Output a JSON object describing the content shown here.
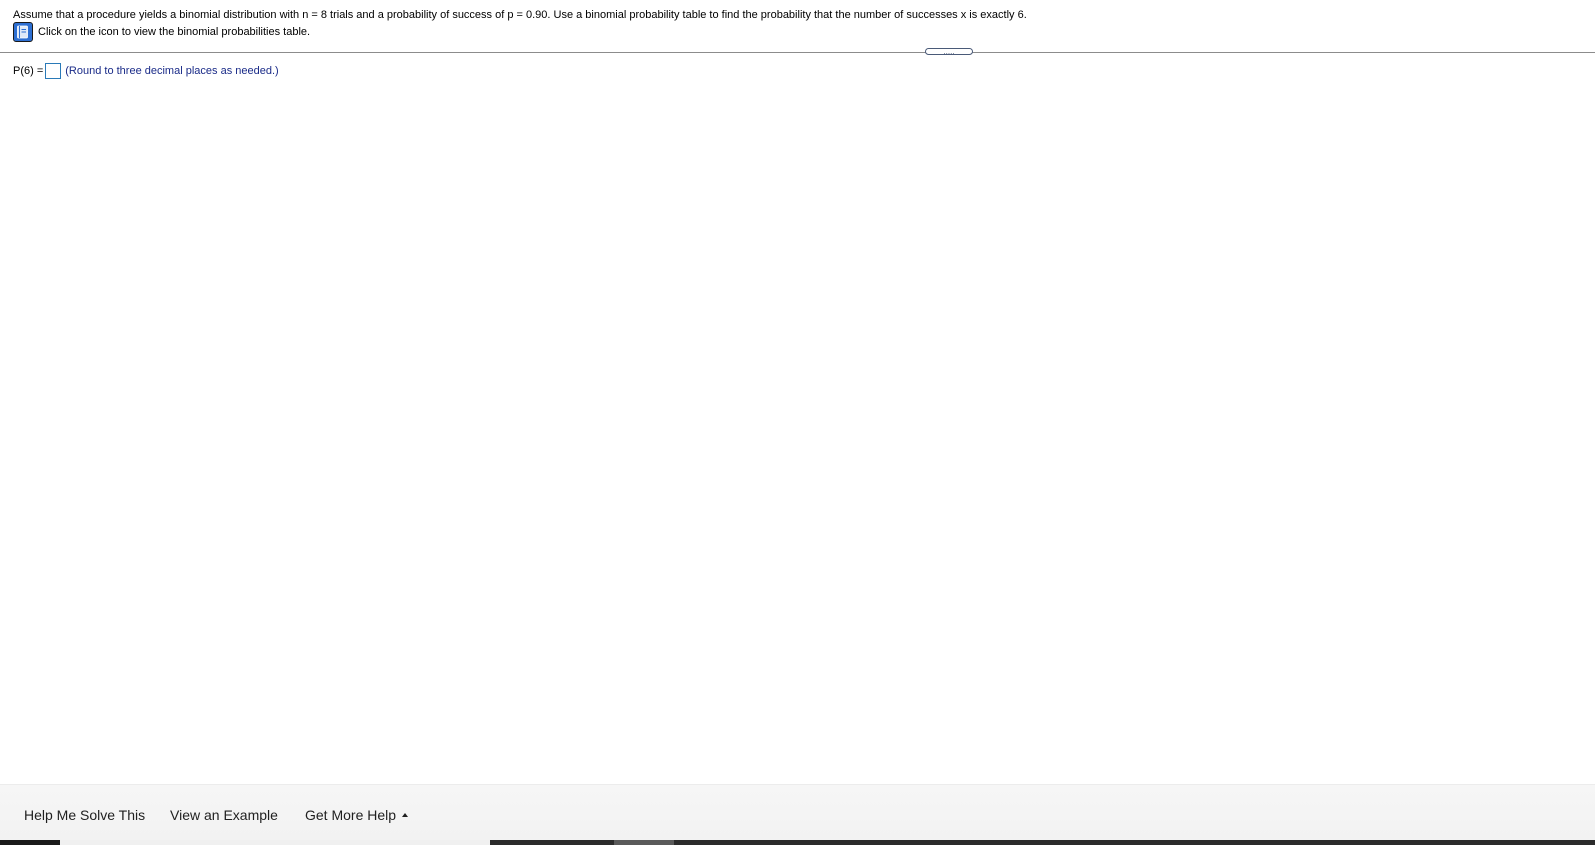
{
  "question": {
    "text": "Assume that a procedure yields a binomial distribution with n = 8 trials and a probability of success of p = 0.90. Use a binomial probability table to find the probability that the number of successes x is exactly 6."
  },
  "table_link": {
    "icon": "book-table-icon",
    "text": "Click on the icon to view the binomial probabilities table."
  },
  "divider": {
    "handle_glyph": "....."
  },
  "answer": {
    "label": "P(6) =",
    "value": "",
    "hint": "(Round to three decimal places as needed.)"
  },
  "help_bar": {
    "help_me_solve": "Help Me Solve This",
    "view_example": "View an Example",
    "get_more_help": "Get More Help"
  },
  "colors": {
    "icon_blue": "#2d6fd2",
    "hint_text": "#1a2b88",
    "input_border": "#2a7ab8"
  }
}
